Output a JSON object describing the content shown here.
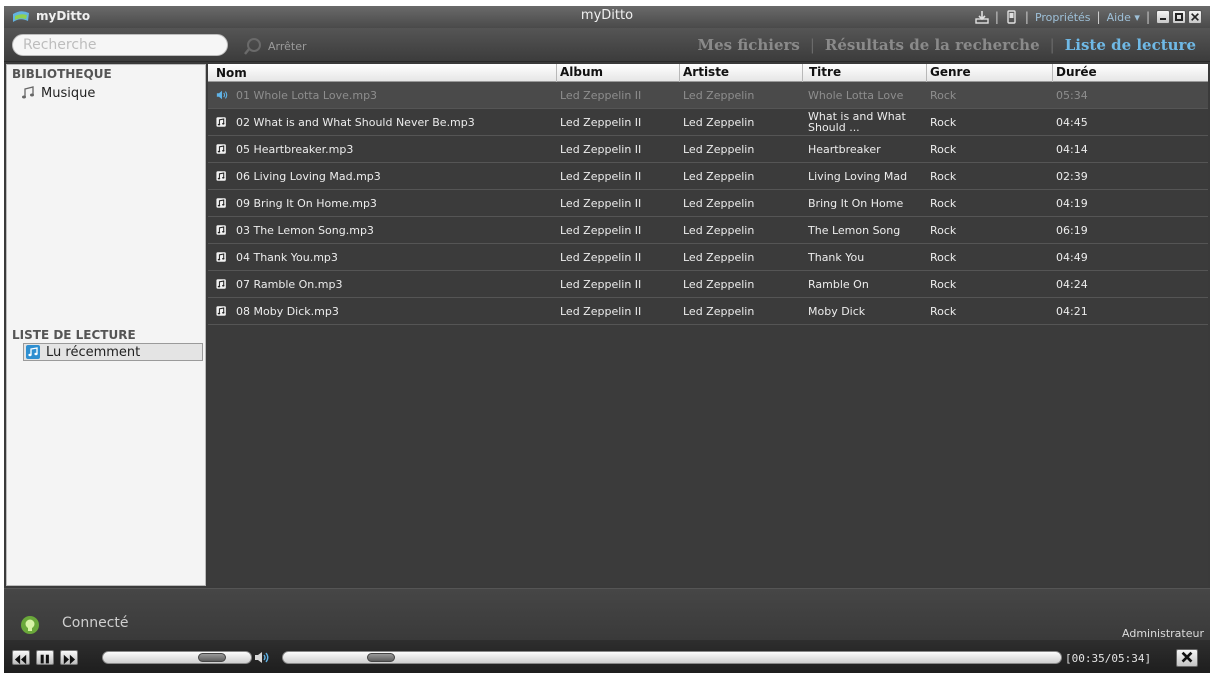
{
  "app": {
    "logo_text": "myDitto",
    "window_title": "myDitto",
    "title_links": {
      "properties": "Propriétés",
      "help": "Aide",
      "sep": "|"
    }
  },
  "search": {
    "placeholder": "Recherche",
    "stop_label": "Arrêter"
  },
  "nav": {
    "tabs": [
      {
        "label": "Mes fichiers",
        "active": false
      },
      {
        "label": "Résultats de la recherche",
        "active": false
      },
      {
        "label": "Liste de lecture",
        "active": true
      }
    ],
    "sep": "|"
  },
  "sidebar": {
    "library_header": "BIBLIOTHEQUE",
    "library_items": [
      {
        "label": "Musique",
        "icon": "music-note-icon"
      }
    ],
    "playlist_header": "LISTE DE LECTURE",
    "playlist_items": [
      {
        "label": "Lu récemment",
        "icon": "music-note-icon",
        "selected": true
      }
    ]
  },
  "table": {
    "columns": [
      "Nom",
      "Album",
      "Artiste",
      "Titre",
      "Genre",
      "Durée"
    ],
    "rows": [
      {
        "nom": "01 Whole Lotta Love.mp3",
        "album": "Led Zeppelin II",
        "artist": "Led Zeppelin",
        "title": "Whole Lotta Love",
        "genre": "Rock",
        "duration": "05:34",
        "playing": true
      },
      {
        "nom": "02 What is and What Should Never Be.mp3",
        "album": "Led Zeppelin II",
        "artist": "Led Zeppelin",
        "title": "What is and What Should ...",
        "genre": "Rock",
        "duration": "04:45",
        "playing": false
      },
      {
        "nom": "05 Heartbreaker.mp3",
        "album": "Led Zeppelin II",
        "artist": "Led Zeppelin",
        "title": "Heartbreaker",
        "genre": "Rock",
        "duration": "04:14",
        "playing": false
      },
      {
        "nom": "06 Living Loving Mad.mp3",
        "album": "Led Zeppelin II",
        "artist": "Led Zeppelin",
        "title": "Living Loving Mad",
        "genre": "Rock",
        "duration": "02:39",
        "playing": false
      },
      {
        "nom": "09 Bring It On Home.mp3",
        "album": "Led Zeppelin II",
        "artist": "Led Zeppelin",
        "title": "Bring It On Home",
        "genre": "Rock",
        "duration": "04:19",
        "playing": false
      },
      {
        "nom": "03 The Lemon Song.mp3",
        "album": "Led Zeppelin II",
        "artist": "Led Zeppelin",
        "title": "The Lemon Song",
        "genre": "Rock",
        "duration": "06:19",
        "playing": false
      },
      {
        "nom": "04 Thank You.mp3",
        "album": "Led Zeppelin II",
        "artist": "Led Zeppelin",
        "title": "Thank You",
        "genre": "Rock",
        "duration": "04:49",
        "playing": false
      },
      {
        "nom": "07 Ramble On.mp3",
        "album": "Led Zeppelin II",
        "artist": "Led Zeppelin",
        "title": "Ramble On",
        "genre": "Rock",
        "duration": "04:24",
        "playing": false
      },
      {
        "nom": "08 Moby Dick.mp3",
        "album": "Led Zeppelin II",
        "artist": "Led Zeppelin",
        "title": "Moby Dick",
        "genre": "Rock",
        "duration": "04:21",
        "playing": false
      }
    ]
  },
  "status": {
    "connection": "Connecté",
    "user": "Administrateur",
    "connection_color": "#8fd14f"
  },
  "player": {
    "time": "[00:35/05:34]",
    "volume_fraction": 0.8,
    "seek_fraction": 0.11
  },
  "colors": {
    "accent": "#6fb9e6",
    "inactive_tab": "#8a8a8a"
  }
}
